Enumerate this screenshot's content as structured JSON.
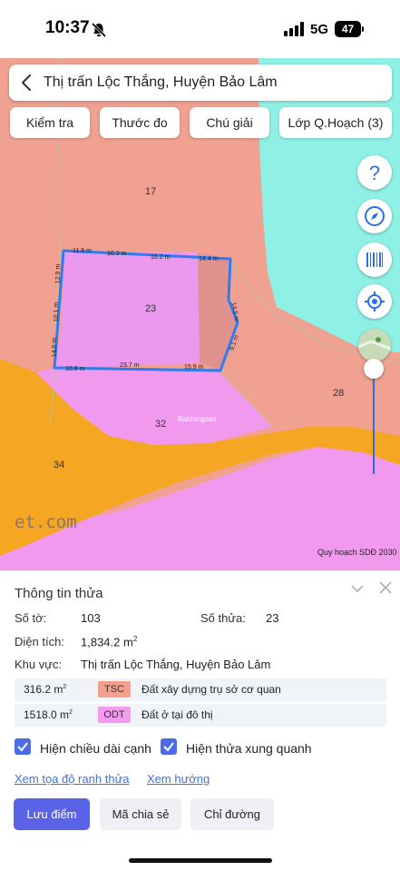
{
  "status_bar": {
    "time": "10:37",
    "network": "5G",
    "battery": "47"
  },
  "search": {
    "title": "Thị trấn Lộc Thắng, Huyện Bảo Lâm"
  },
  "tabs": [
    {
      "label": "Kiểm tra"
    },
    {
      "label": "Thước đo"
    },
    {
      "label": "Chú giải"
    },
    {
      "label": "Lớp Q.Hoạch (3)"
    }
  ],
  "fabs": [
    {
      "icon": "help-icon",
      "symbol": "?"
    },
    {
      "icon": "compass-icon"
    },
    {
      "icon": "barcode-icon"
    },
    {
      "icon": "locate-icon"
    }
  ],
  "map": {
    "parcel_labels": [
      "17",
      "23",
      "28",
      "32",
      "34"
    ],
    "dimensions": [
      "11.5 m",
      "10.3 m",
      "16.2 m",
      "14.4 m",
      "12.9 m",
      "10.1 m",
      "14.0 m",
      "14.5 m",
      "9.1 m",
      "10.8 m",
      "23.7 m",
      "15.9 m"
    ],
    "watermark": "et.com",
    "site_mark": "Batdongsan",
    "credit": "Quy hoạch SDĐ 2030",
    "colors": {
      "residential": "#f199ef",
      "commercial": "#f0a191",
      "road": "#f5a623",
      "water": "#8ff0e6",
      "parcel_outline": "#2d7cf0"
    }
  },
  "panel": {
    "title": "Thông tin thửa",
    "sheet_label": "Số tờ:",
    "sheet_value": "103",
    "parcel_label": "Số thửa:",
    "parcel_value": "23",
    "area_label": "Diện tích:",
    "area_value": "1,834.2 m",
    "area_unit_sup": "2",
    "region_label": "Khu vực:",
    "region_value": "Thị trấn Lộc Thắng, Huyện Bảo Lâm",
    "uses": [
      {
        "area": "316.2 m",
        "sup": "2",
        "code": "TSC",
        "desc": "Đất xây dựng trụ sở cơ quan",
        "color": "#f3a08e"
      },
      {
        "area": "1518.0 m",
        "sup": "2",
        "code": "ODT",
        "desc": "Đất ở tại đô thị",
        "color": "#f39bee"
      }
    ],
    "checkbox_edges": "Hiện chiều dài cạnh",
    "checkbox_neighbors": "Hiện thửa xung quanh",
    "link_coords": "Xem tọa độ ranh thửa",
    "link_direction": "Xem hướng",
    "btn_save": "Lưu điểm",
    "btn_share": "Mã chia sẻ",
    "btn_route": "Chỉ đường"
  }
}
